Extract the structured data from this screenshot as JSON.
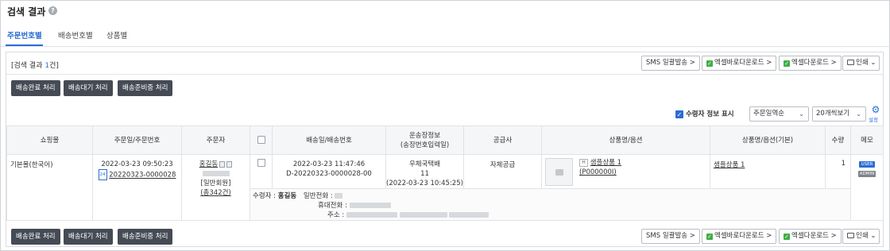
{
  "page": {
    "title": "검색 결과"
  },
  "tabs": [
    "주문번호별",
    "배송번호별",
    "상품별"
  ],
  "result": {
    "label_prefix": "[검색 결과 ",
    "count": "1",
    "label_suffix": "건]"
  },
  "toolbar": {
    "sms": "SMS 일괄발송 >",
    "excel_direct": "엑셀바로다운로드 >",
    "excel": "엑셀다운로드 >",
    "print": "인쇄",
    "print_arrow": "⌄"
  },
  "actions": {
    "done": "배송완료 처리",
    "wait": "배송대기 처리",
    "preparing": "배송준비중 처리"
  },
  "options": {
    "show_recipient_label": "수령자 정보 표시",
    "show_recipient_checked": true,
    "sort_select": "주문일역순",
    "page_size_select": "20개씩보기",
    "settings_label": "설정"
  },
  "columns": [
    "쇼핑몰",
    "주문일/주문번호",
    "주문자",
    "",
    "배송일/배송번호",
    "운송장정보\n(송장번호입력일)",
    "공급사",
    "상품명/옵션",
    "상품명/옵션(기본)",
    "수량",
    "메모"
  ],
  "row": {
    "mall": "기본몰(한국어)",
    "order_date": "2022-03-23 09:50:23",
    "order_badge": "24",
    "order_no": "20220323-0000028",
    "orderer_name": "홍길동",
    "member_type": "[일반회원]",
    "order_count": "(총342건)",
    "ship_date": "2022-03-23 11:47:46",
    "ship_no": "D-20220323-0000028-00",
    "carrier": "우체국택배",
    "tracking": "11",
    "tracking_date": "(2022-03-23 10:45:25)",
    "supplier": "자체공급",
    "product_badge": "H",
    "product_name": "샘플상품 1",
    "product_code": "(P000000I)",
    "product_base": "샘플상품 1",
    "qty": "1",
    "memo_user": "USER",
    "memo_admin": "ADMIN"
  },
  "recipient": {
    "label": "수령자 :",
    "name": "홍길동",
    "phone_label": "일반전화 :",
    "mobile_label": "휴대전화 :",
    "address_label": "주소 :"
  }
}
